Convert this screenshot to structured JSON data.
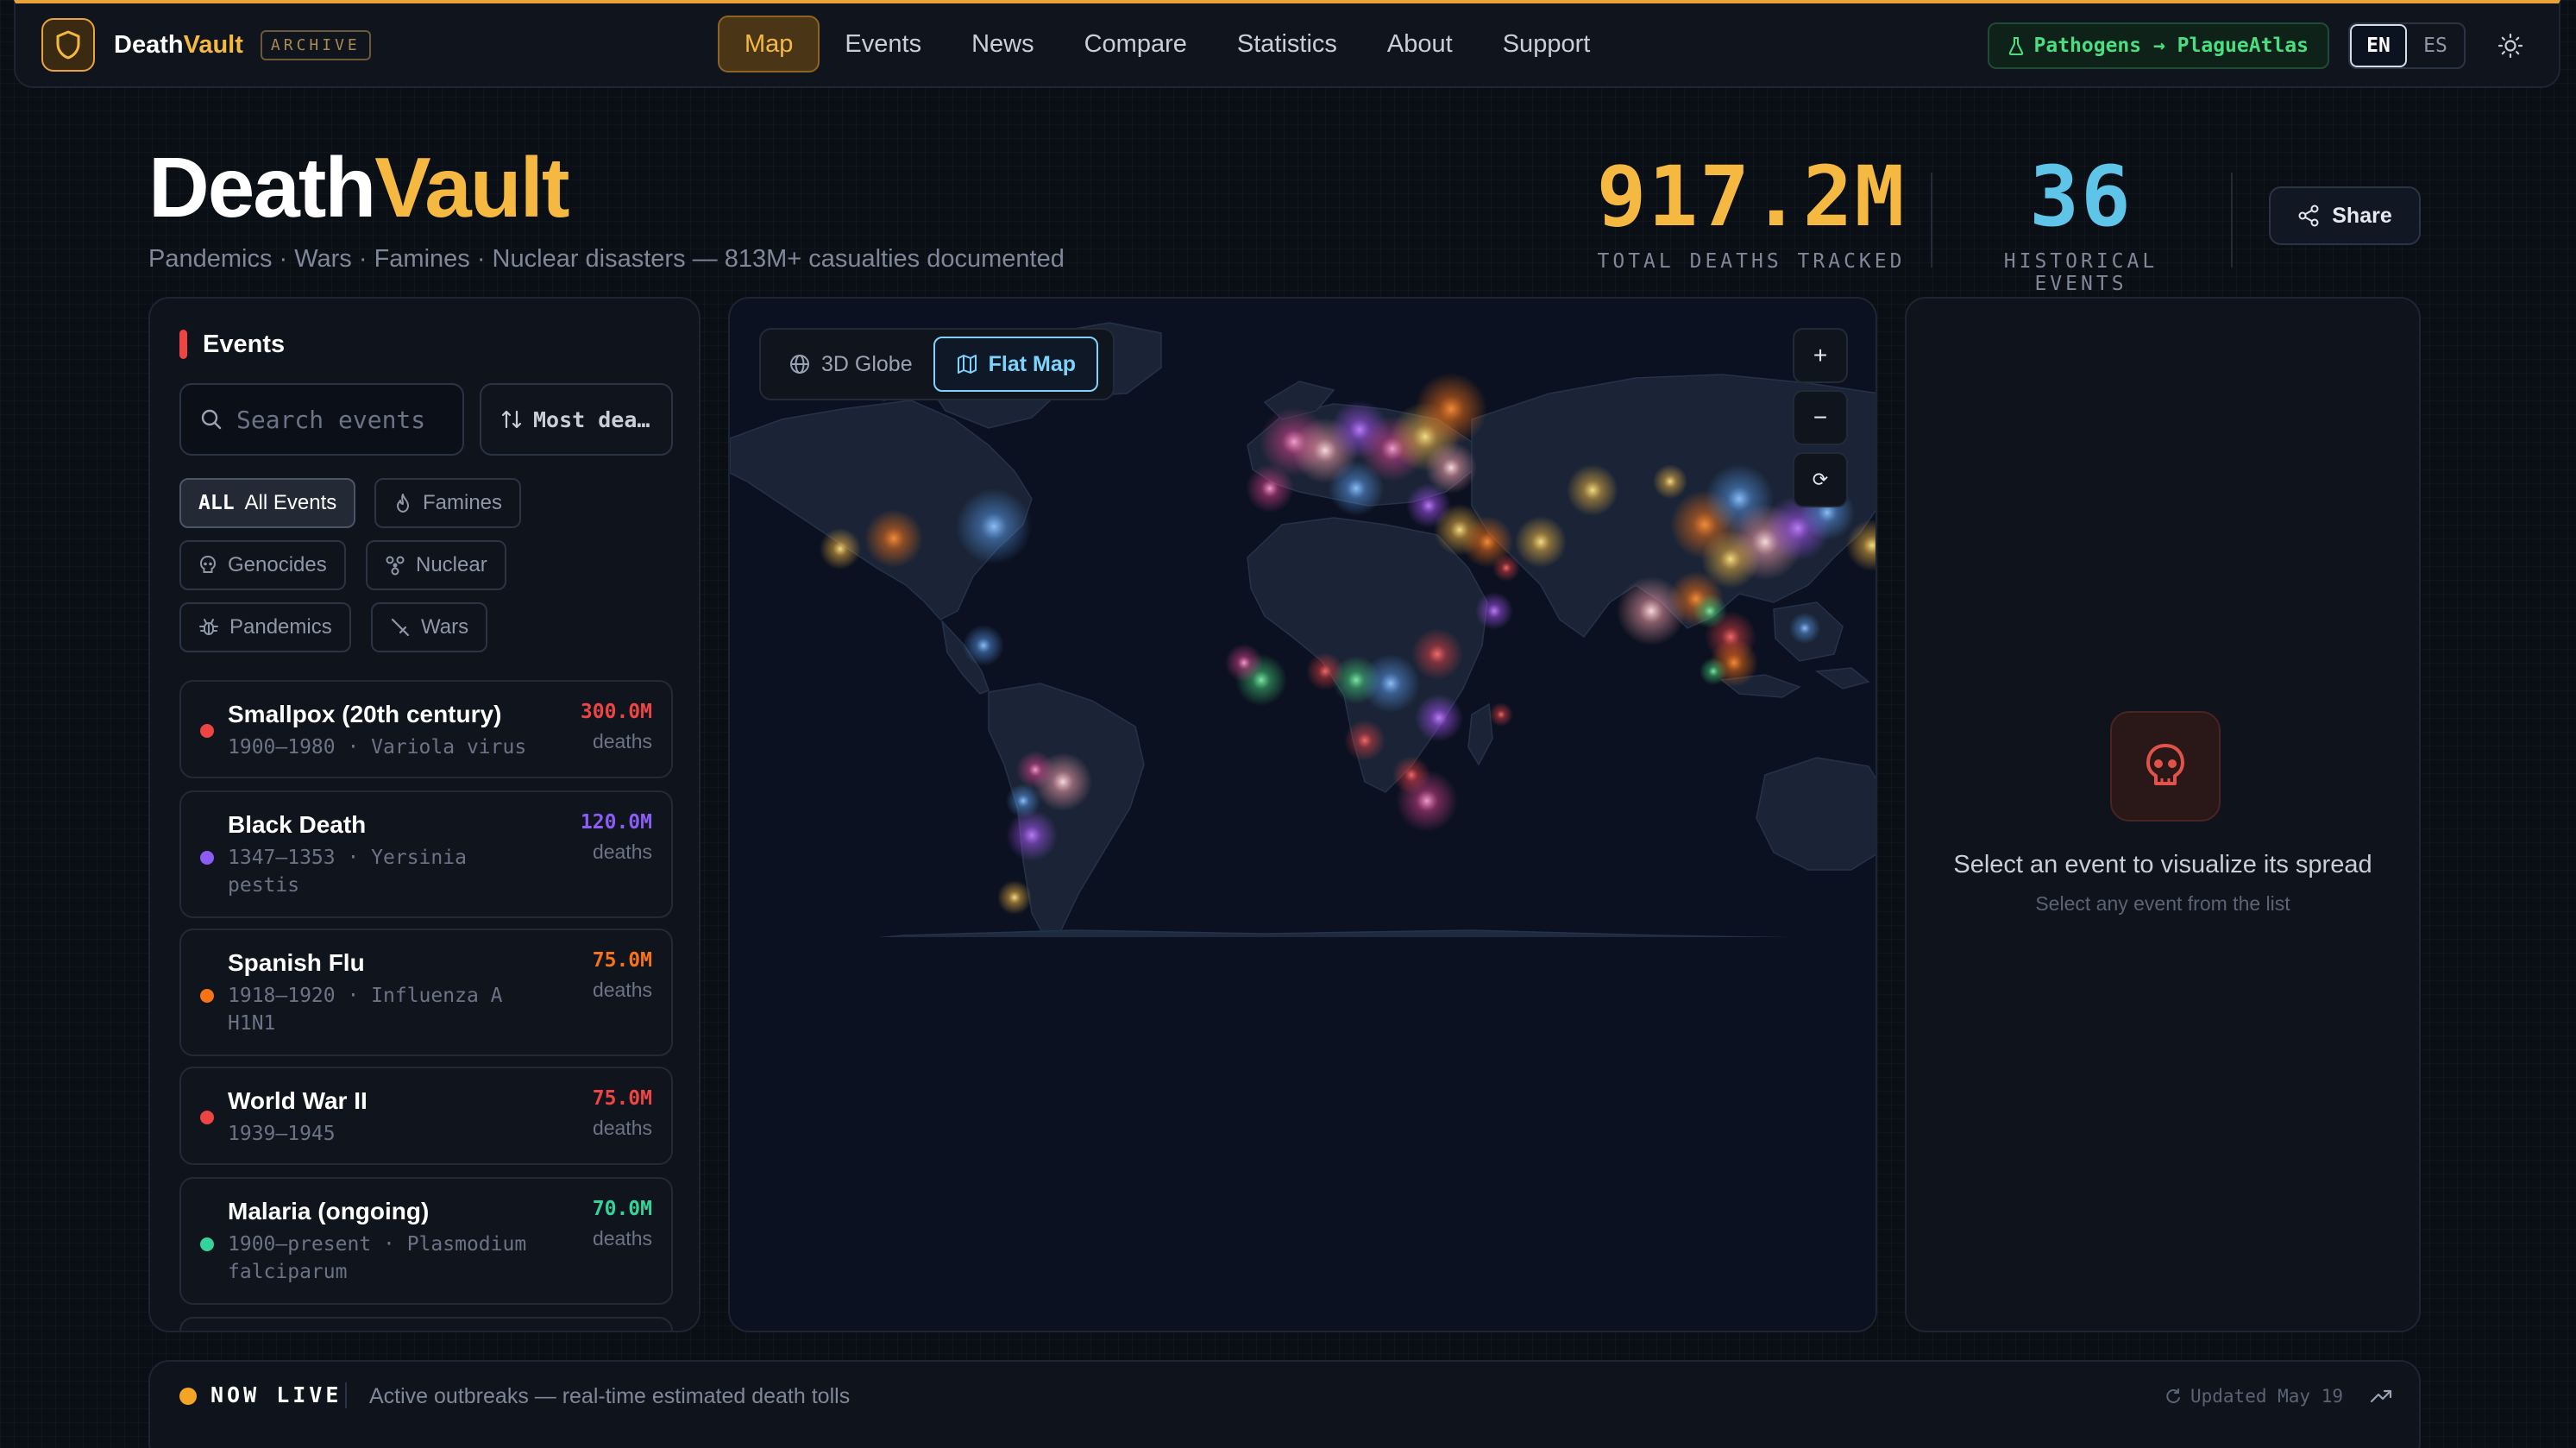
{
  "nav": {
    "brand_part1": "Death",
    "brand_part2": "Vault",
    "badge": "ARCHIVE",
    "links": [
      "Map",
      "Events",
      "News",
      "Compare",
      "Statistics",
      "About",
      "Support"
    ],
    "active_link": "Map",
    "pathogens_link": "Pathogens → PlagueAtlas",
    "languages": [
      "EN",
      "ES"
    ],
    "active_language": "EN",
    "theme_icon": "sun-icon"
  },
  "hero": {
    "title_part1": "Death",
    "title_part2": "Vault",
    "subtitle": "Pandemics · Wars · Famines · Nuclear disasters — 813M+ casualties documented",
    "stats": [
      {
        "value": "917.2M",
        "label": "TOTAL DEATHS TRACKED",
        "color": "#f5b942"
      },
      {
        "value": "36",
        "label": "HISTORICAL EVENTS",
        "color": "#5ec4e8"
      }
    ],
    "share_label": "Share"
  },
  "events_panel": {
    "title": "Events",
    "search_placeholder": "Search events",
    "sort_label": "Most dea…",
    "filters": [
      {
        "tag": "ALL",
        "label": "All Events",
        "icon": "all-icon",
        "active": true
      },
      {
        "label": "Famines",
        "icon": "flame-icon"
      },
      {
        "label": "Genocides",
        "icon": "skull-icon"
      },
      {
        "label": "Nuclear",
        "icon": "radiation-icon"
      },
      {
        "label": "Pandemics",
        "icon": "bug-icon"
      },
      {
        "label": "Wars",
        "icon": "sword-icon"
      }
    ],
    "events": [
      {
        "name": "Smallpox (20th century)",
        "meta1": "1900–1980 · Variola virus",
        "meta2": "",
        "value": "300.0M",
        "unit": "deaths",
        "color": "#ef4444"
      },
      {
        "name": "Black Death",
        "meta1": "1347–1353 · Yersinia",
        "meta2": "pestis",
        "value": "120.0M",
        "unit": "deaths",
        "color": "#8b5cf6"
      },
      {
        "name": "Spanish Flu",
        "meta1": "1918–1920 · Influenza A",
        "meta2": "H1N1",
        "value": "75.0M",
        "unit": "deaths",
        "color": "#f97316"
      },
      {
        "name": "World War II",
        "meta1": "1939–1945",
        "meta2": "",
        "value": "75.0M",
        "unit": "deaths",
        "color": "#ef4444"
      },
      {
        "name": "Malaria (ongoing)",
        "meta1": "1900–present · Plasmodium",
        "meta2": "falciparum",
        "value": "70.0M",
        "unit": "deaths",
        "color": "#34d399"
      }
    ]
  },
  "map": {
    "modes": [
      "3D Globe",
      "Flat Map"
    ],
    "active_mode": "Flat Map",
    "zoom_in": "+",
    "zoom_out": "−",
    "reset": "⟳"
  },
  "detail": {
    "title": "Select an event to visualize its spread",
    "subtitle": "Select any event from the list",
    "icon": "skull-icon"
  },
  "live": {
    "label": "NOW LIVE",
    "description": "Active outbreaks — real-time estimated death tolls",
    "updated": "Updated May 19"
  }
}
